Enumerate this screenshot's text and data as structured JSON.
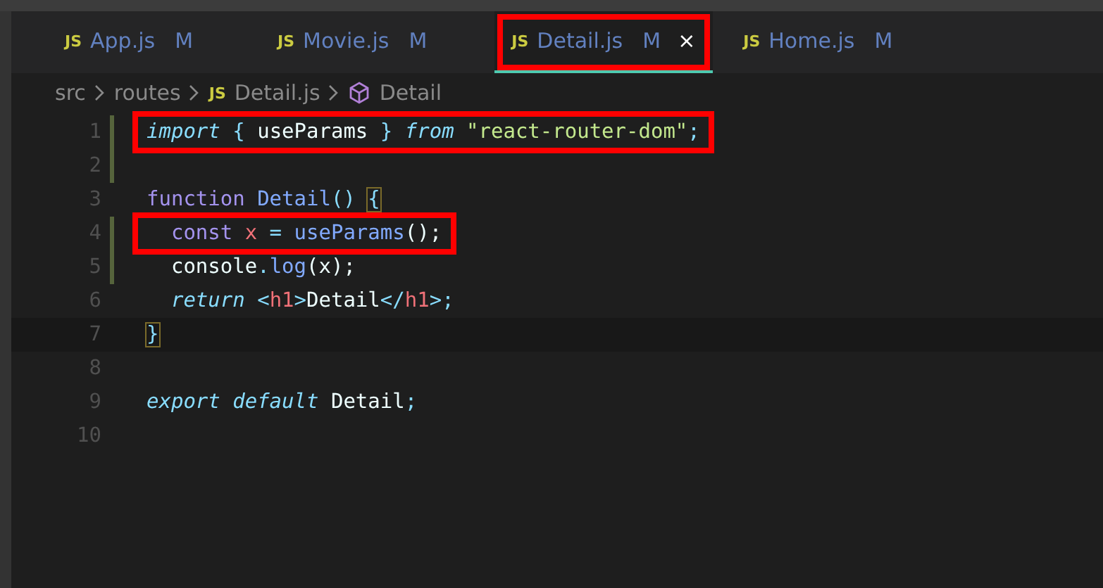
{
  "tabs": [
    {
      "icon": "JS",
      "label": "App.js",
      "badge": "M",
      "selected": false
    },
    {
      "icon": "JS",
      "label": "Movie.js",
      "badge": "M",
      "selected": false
    },
    {
      "icon": "JS",
      "label": "Detail.js",
      "badge": "M",
      "close": "×",
      "selected": true,
      "annotated": true
    },
    {
      "icon": "JS",
      "label": "Home.js",
      "badge": "M",
      "selected": false
    }
  ],
  "breadcrumb": [
    {
      "kind": "folder",
      "text": "src"
    },
    {
      "kind": "folder",
      "text": "routes"
    },
    {
      "kind": "file",
      "icon": "JS",
      "text": "Detail.js"
    },
    {
      "kind": "symbol",
      "text": "Detail"
    }
  ],
  "lines": [
    {
      "number": "1",
      "modified": true,
      "annotated": true,
      "tokens": [
        {
          "kind": "keyword",
          "text": "import"
        },
        {
          "kind": "punct",
          "text": " { "
        },
        {
          "kind": "plain",
          "text": "useParams"
        },
        {
          "kind": "punct",
          "text": " } "
        },
        {
          "kind": "keyword",
          "text": "from"
        },
        {
          "kind": "string",
          "text": " \"react-router-dom\""
        },
        {
          "kind": "punct",
          "text": ";"
        }
      ]
    },
    {
      "number": "2",
      "modified": true
    },
    {
      "number": "3",
      "tokens": [
        {
          "kind": "storage",
          "text": "function"
        },
        {
          "kind": "function",
          "text": " Detail"
        },
        {
          "kind": "punct",
          "text": "() "
        },
        {
          "kind": "bracket",
          "text": "{"
        }
      ]
    },
    {
      "number": "4",
      "modified": true,
      "annotated": true,
      "tokens": [
        {
          "kind": "storage",
          "text": "  const"
        },
        {
          "kind": "variable",
          "text": " x"
        },
        {
          "kind": "punct",
          "text": " = "
        },
        {
          "kind": "function",
          "text": "useParams"
        },
        {
          "kind": "plain",
          "text": "();"
        }
      ]
    },
    {
      "number": "5",
      "modified": true,
      "tokens": [
        {
          "kind": "plain",
          "text": "  console"
        },
        {
          "kind": "punct",
          "text": "."
        },
        {
          "kind": "function",
          "text": "log"
        },
        {
          "kind": "plain",
          "text": "(x);"
        }
      ]
    },
    {
      "number": "6",
      "tokens": [
        {
          "kind": "keyword",
          "text": "  return"
        },
        {
          "kind": "punct",
          "text": " <"
        },
        {
          "kind": "variable",
          "text": "h1"
        },
        {
          "kind": "punct",
          "text": ">"
        },
        {
          "kind": "plain",
          "text": "Detail"
        },
        {
          "kind": "punct",
          "text": "</"
        },
        {
          "kind": "variable",
          "text": "h1"
        },
        {
          "kind": "punct",
          "text": ">;"
        }
      ]
    },
    {
      "number": "7",
      "current": true,
      "tokens": [
        {
          "kind": "bracket",
          "text": "}"
        }
      ]
    },
    {
      "number": "8"
    },
    {
      "number": "9",
      "tokens": [
        {
          "kind": "keyword",
          "text": "export"
        },
        {
          "kind": "keyword",
          "text": " default"
        },
        {
          "kind": "plain",
          "text": " Detail"
        },
        {
          "kind": "punct",
          "text": ";"
        }
      ]
    },
    {
      "number": "10"
    }
  ]
}
